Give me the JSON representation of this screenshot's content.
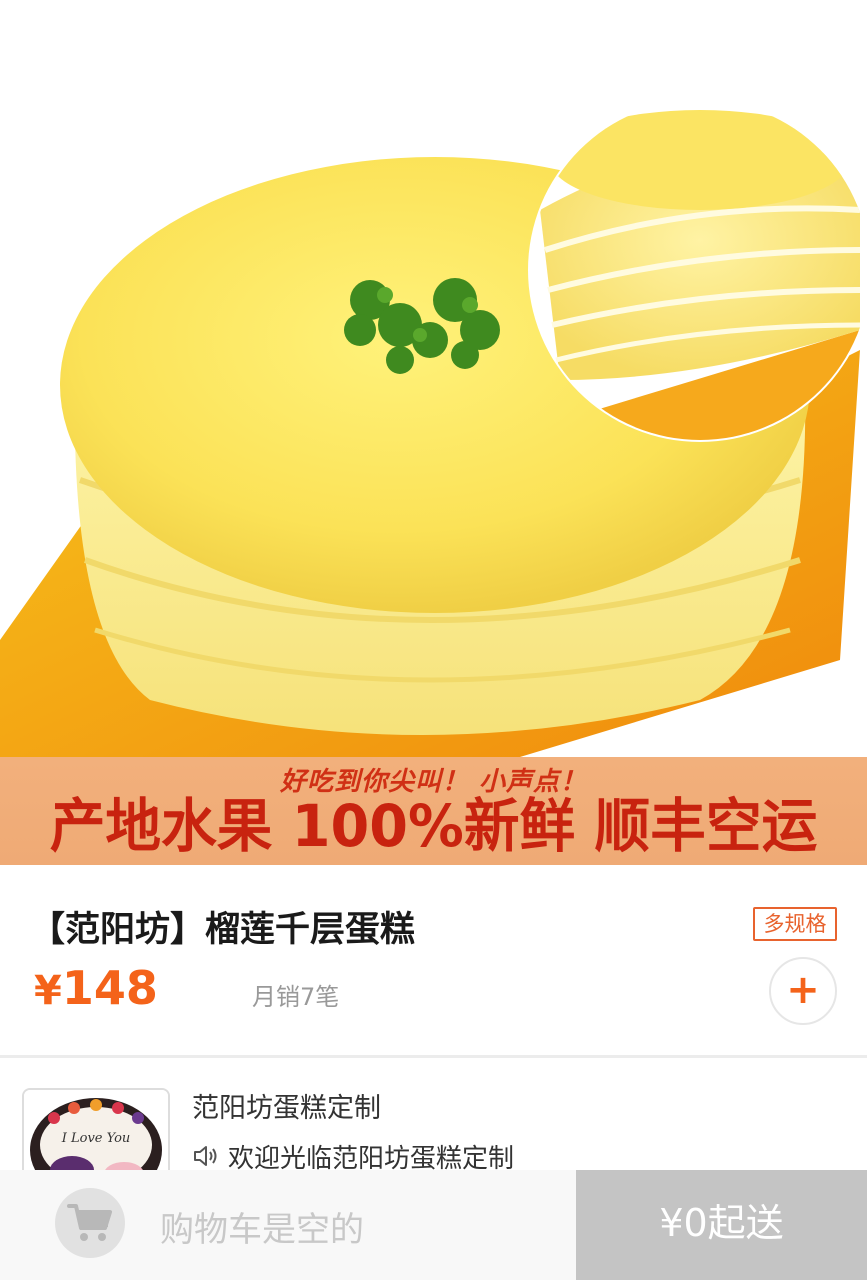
{
  "banner": {
    "tagline": "好吃到你尖叫！ 小声点！",
    "headline": "产地水果 100%新鲜 顺丰空运"
  },
  "product": {
    "name": "【范阳坊】榴莲千层蛋糕",
    "spec_tag": "多规格",
    "price_currency": "¥",
    "price_value": "148",
    "monthly_sales": "月销7笔",
    "add_label": "+"
  },
  "shop": {
    "name": "范阳坊蛋糕定制",
    "notice": "欢迎光临范阳坊蛋糕定制",
    "thumb_text": "I Love You"
  },
  "cart": {
    "empty_text": "购物车是空的",
    "min_order": "¥0起送"
  },
  "icons": {
    "cart": "shopping-cart-icon",
    "speaker": "speaker-icon",
    "plus": "plus-icon"
  },
  "colors": {
    "accent": "#f4631a",
    "banner_bg": "#efaa75",
    "banner_text": "#c8230f",
    "checkout_bg": "#c4c4c4"
  }
}
